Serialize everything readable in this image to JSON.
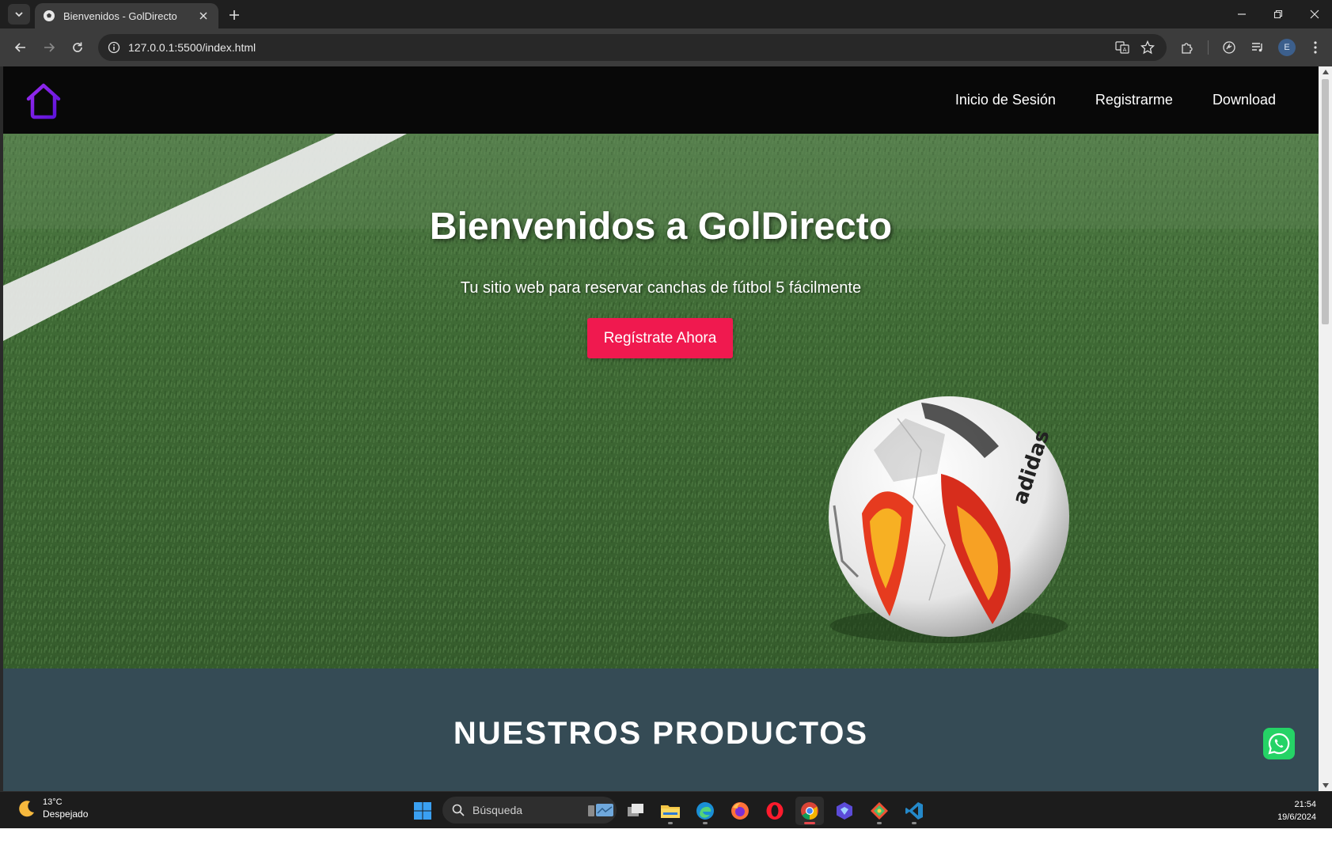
{
  "browser": {
    "tab_title": "Bienvenidos - GolDirecto",
    "url": "127.0.0.1:5500/index.html",
    "profile_initial": "E"
  },
  "site": {
    "brand_color": "#7b1fe0",
    "nav": {
      "login": "Inicio de Sesión",
      "register": "Registrarme",
      "download": "Download"
    },
    "hero": {
      "title": "Bienvenidos a GolDirecto",
      "subtitle": "Tu sitio web para reservar canchas de fútbol 5 fácilmente",
      "cta_label": "Regístrate Ahora",
      "cta_color": "#f0194f"
    },
    "products": {
      "title": "NUESTROS PRODUCTOS"
    },
    "whatsapp_color": "#25d366"
  },
  "taskbar": {
    "weather_temp": "13°C",
    "weather_desc": "Despejado",
    "search_placeholder": "Búsqueda",
    "time": "21:54",
    "date": "19/6/2024",
    "apps": [
      "windows-start-icon",
      "task-view-icon",
      "file-explorer-icon",
      "edge-icon",
      "firefox-icon",
      "opera-icon",
      "chrome-icon",
      "app-cube-icon",
      "git-kraken-icon",
      "vscode-icon"
    ]
  }
}
